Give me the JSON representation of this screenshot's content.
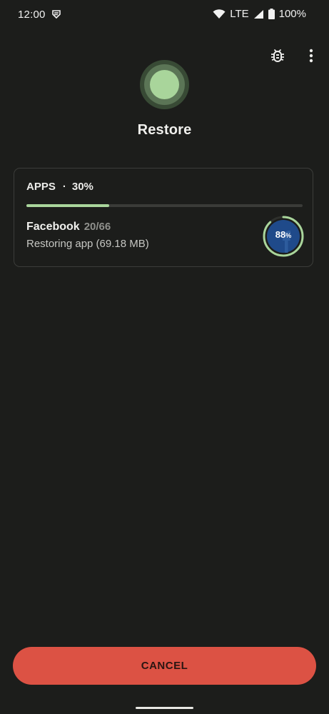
{
  "status_bar": {
    "time": "12:00",
    "network": "LTE",
    "battery": "100%",
    "icons": [
      "shield-notification-icon",
      "wifi-icon",
      "signal-icon",
      "battery-icon"
    ]
  },
  "toolbar": {
    "icons": [
      "bug-icon",
      "more-vert-icon"
    ]
  },
  "header": {
    "title": "Restore",
    "icon": "restore-status-icon"
  },
  "card": {
    "section_label": "APPS",
    "separator": "·",
    "overall_percent": "30%",
    "overall_progress": 0.3,
    "app_name": "Facebook",
    "app_count": "20/66",
    "app_status": "Restoring app (69.18 MB)",
    "app_percent_value": "88",
    "app_percent_unit": "%",
    "app_progress": 0.88
  },
  "footer": {
    "cancel_label": "CANCEL"
  },
  "colors": {
    "background": "#1c1d1b",
    "accent": "#a9d59b",
    "cancel": "#dc5244",
    "app_icon": "#1f4a8a"
  }
}
